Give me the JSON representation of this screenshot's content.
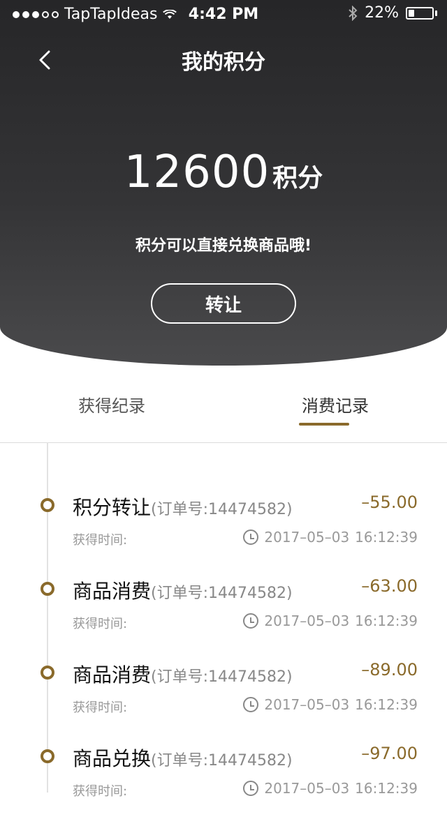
{
  "status_bar": {
    "carrier": "TapTapIdeas",
    "time": "4:42 PM",
    "battery_percent": "22%"
  },
  "header": {
    "title": "我的积分",
    "points_value": "12600",
    "points_unit": "积分",
    "hint": "积分可以直接兑换商品哦!",
    "transfer_label": "转让"
  },
  "tabs": [
    {
      "label": "获得纪录",
      "active": false
    },
    {
      "label": "消费记录",
      "active": true
    }
  ],
  "records": [
    {
      "title": "积分转让",
      "order": "(订单号:14474582)",
      "amount": "–55.00",
      "time_label": "获得时间:",
      "date": "2017–05–03",
      "time": "16:12:39"
    },
    {
      "title": "商品消费",
      "order": "(订单号:14474582)",
      "amount": "–63.00",
      "time_label": "获得时间:",
      "date": "2017–05–03",
      "time": "16:12:39"
    },
    {
      "title": "商品消费",
      "order": "(订单号:14474582)",
      "amount": "–89.00",
      "time_label": "获得时间:",
      "date": "2017–05–03",
      "time": "16:12:39"
    },
    {
      "title": "商品兑换",
      "order": "(订单号:14474582)",
      "amount": "–97.00",
      "time_label": "获得时间:",
      "date": "2017–05–03",
      "time": "16:12:39"
    }
  ],
  "colors": {
    "accent": "#8a6a2b",
    "header_dark": "#262628"
  },
  "icons": {
    "back": "chevron-left-icon",
    "clock": "clock-icon",
    "wifi": "wifi-icon",
    "bluetooth": "bluetooth-icon",
    "battery": "battery-icon"
  }
}
